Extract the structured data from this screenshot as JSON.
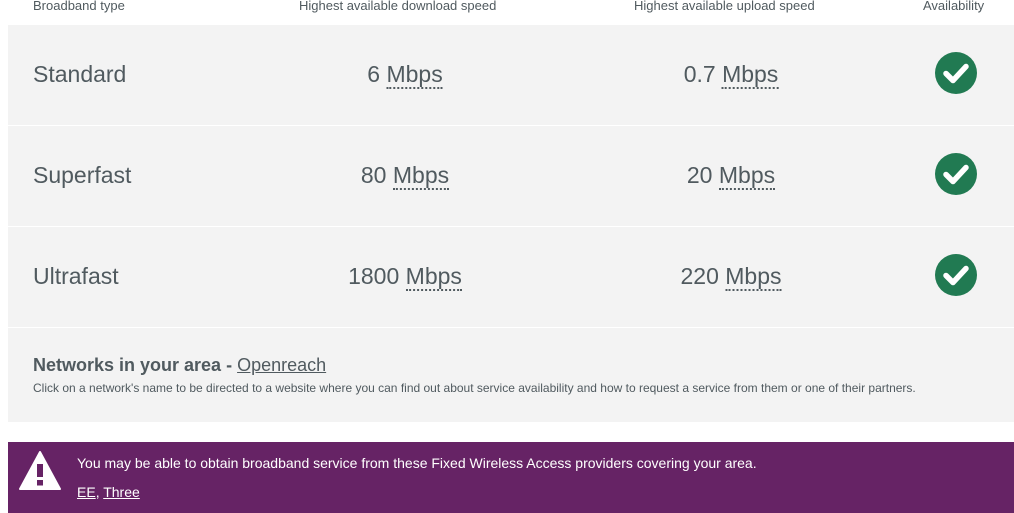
{
  "header": {
    "type": "Broadband type",
    "download": "Highest available download speed",
    "upload": "Highest available upload speed",
    "availability": "Availability"
  },
  "rows": [
    {
      "type": "Standard",
      "down_value": "6",
      "up_value": "0.7",
      "unit": "Mbps",
      "available": true
    },
    {
      "type": "Superfast",
      "down_value": "80",
      "up_value": "20",
      "unit": "Mbps",
      "available": true
    },
    {
      "type": "Ultrafast",
      "down_value": "1800",
      "up_value": "220",
      "unit": "Mbps",
      "available": true
    }
  ],
  "networks": {
    "title": "Networks in your area",
    "separator": " - ",
    "link": "Openreach",
    "description": "Click on a network's name to be directed to a website where you can find out about service availability and how to request a service from them or one of their partners."
  },
  "warning": {
    "text": "You may be able to obtain broadband service from these Fixed Wireless Access providers covering your area.",
    "providers": [
      "EE",
      "Three"
    ],
    "provider_separator": ", "
  },
  "colors": {
    "panel_bg": "#f3f3f3",
    "check_green": "#217a52",
    "warning_purple": "#662365",
    "text": "#505a5f"
  }
}
